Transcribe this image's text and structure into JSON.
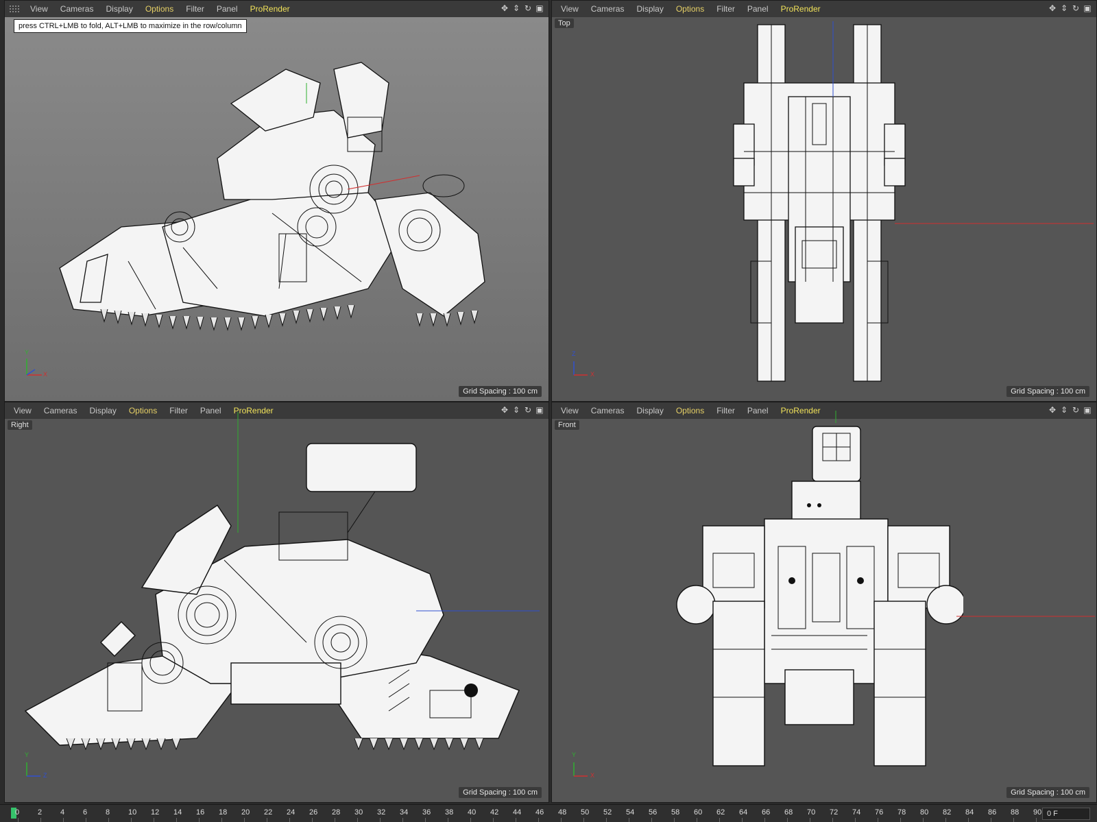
{
  "menu": {
    "items": [
      "View",
      "Cameras",
      "Display",
      "Options",
      "Filter",
      "Panel",
      "ProRender"
    ]
  },
  "viewports": {
    "perspective": {
      "tooltip": "press CTRL+LMB to fold, ALT+LMB to maximize in the row/column",
      "grid": "Grid Spacing : 100 cm"
    },
    "top": {
      "label": "Top",
      "grid": "Grid Spacing : 100 cm"
    },
    "right": {
      "label": "Right",
      "grid": "Grid Spacing : 100 cm"
    },
    "front": {
      "label": "Front",
      "grid": "Grid Spacing : 100 cm"
    }
  },
  "axes": {
    "x": "X",
    "y": "Y",
    "z": "Z"
  },
  "timeline": {
    "ticks": [
      "0",
      "2",
      "4",
      "6",
      "8",
      "10",
      "12",
      "14",
      "16",
      "18",
      "20",
      "22",
      "24",
      "26",
      "28",
      "30",
      "32",
      "34",
      "36",
      "38",
      "40",
      "42",
      "44",
      "46",
      "48",
      "50",
      "52",
      "54",
      "56",
      "58",
      "60",
      "62",
      "64",
      "66",
      "68",
      "70",
      "72",
      "74",
      "76",
      "78",
      "80",
      "82",
      "84",
      "86",
      "88",
      "90"
    ],
    "current_frame": "0 F"
  },
  "colors": {
    "accent_options": "#e6d066",
    "accent_prorender": "#f2e35a",
    "playhead": "#35c36b",
    "axis_x": "#d03030",
    "axis_y": "#30b030",
    "axis_z": "#3050d0"
  }
}
